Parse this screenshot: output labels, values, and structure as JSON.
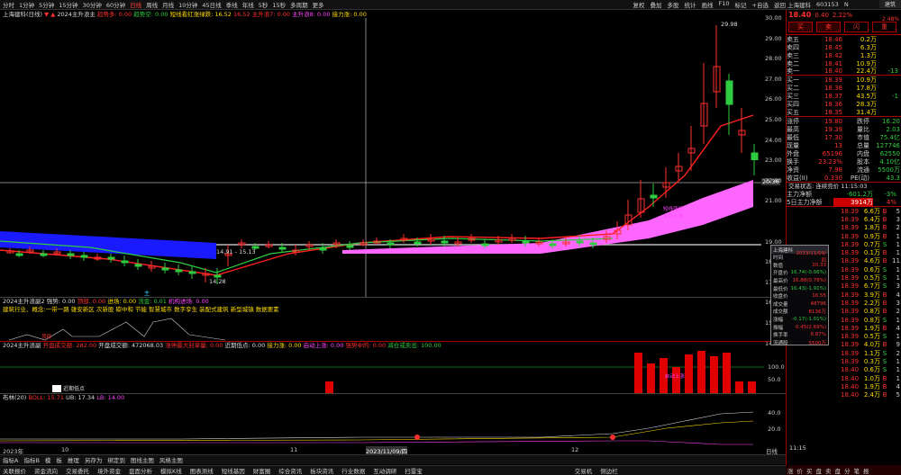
{
  "toolbar": {
    "items": [
      "分时",
      "1分钟",
      "5分钟",
      "15分钟",
      "30分钟",
      "60分钟",
      "日线",
      "周线",
      "月线",
      "10分钟",
      "45日线",
      "季线",
      "年线",
      "5秒",
      "15秒",
      "多周期",
      "更多"
    ],
    "right": [
      "复权",
      "叠加",
      "多股",
      "统计",
      "画线",
      "F10",
      "标记",
      "+自选",
      "返回"
    ]
  },
  "header": {
    "stock": "上海建科(日线)",
    "indicator": "2024主升浪主",
    "s1": "趋势多: 0.00",
    "s2": "趋势空: 0.00",
    "s3": "短线看红涨绿跌: 16.52",
    "s4": "16.52",
    "s5": "主升浪7: 0.00",
    "s6": "主升浪8: 0.00",
    "s7": "接力涨: 0.00"
  },
  "main": {
    "high_label": "29.98",
    "current": "20.36",
    "range": "14.91 - 15.13",
    "low": "14.28",
    "ann": "短线涨红",
    "ann2": "主力入场",
    "y_ticks": [
      "30.00",
      "29.00",
      "28.00",
      "27.00",
      "26.00",
      "25.00",
      "24.00",
      "23.00",
      "22.00",
      "21.00",
      "19.00",
      "18.00",
      "17.00",
      "16.00",
      "15.00",
      "14.00"
    ],
    "mark": "主"
  },
  "p2": {
    "title": "2024主升浪副2",
    "s": "强势: 0.00",
    "s2": "顶部: 0.00",
    "s3": "进场: 0.00",
    "s4": "流金: 0.01",
    "s5": "机构进场: 0.00",
    "text": "建筑行业、概念:一带一路 雄安新区 次新股 碳中和 节能 智慧城市 数字孪生 装配式建筑 新型城镇 数据要素",
    "label": "顶部"
  },
  "p3": {
    "title": "2024主升浪副",
    "s1": "开盘成交额: 282.00",
    "s2": "开盘成交额: 472068.03",
    "s3": "涨停最大封单量: 0.00",
    "s4": "近期低点: 0.00",
    "s5": "接力涨: 0.00",
    "s6": "启动上涨: 0.00",
    "s7": "强势中的: 0.00",
    "s8": "减仓或卖出: 100.00",
    "ticks": [
      "100.0",
      "50.0"
    ],
    "lab1": "近期低点",
    "lab2": "启动上涨"
  },
  "p4": {
    "title": "布林(20)",
    "boll": "BOLL: 15.71",
    "ub": "UB: 17.34",
    "lb": "LB: 14.00",
    "ticks": [
      "40.0",
      "20.0"
    ]
  },
  "xaxis": {
    "labels": [
      "2023年",
      "10",
      "11",
      "2023/11/09/四",
      "12"
    ],
    "unit": "日线"
  },
  "tabs": [
    "指标A",
    "指标B",
    "模",
    "板",
    "推理",
    "另存为",
    "绑定到",
    "图线主图",
    "风格主图"
  ],
  "bottom": [
    "关联报价",
    "资金流向",
    "交易委托",
    "境外资金",
    "盘面分析",
    "模拟K线",
    "图表测线",
    "短线基因",
    "财富圈",
    "综合资讯",
    "板块资讯",
    "行业数据",
    "互动调研",
    "扫雷宝",
    "交易机",
    "侧边栏"
  ],
  "quote": {
    "name": "上海建科",
    "code": "603153",
    "flag": "N",
    "price": "18.40",
    "change": "0.40",
    "pct": "2.22%",
    "tag1": "建筑",
    "tag2": "2.48%",
    "buy": "买",
    "sell": "卖",
    "b3": "闪",
    "b4": "重"
  },
  "book": [
    {
      "l": "卖五",
      "p": "18.46",
      "v": "0.2万",
      "d": ""
    },
    {
      "l": "卖四",
      "p": "18.45",
      "v": "6.3万",
      "d": ""
    },
    {
      "l": "卖三",
      "p": "18.42",
      "v": "1.3万",
      "d": ""
    },
    {
      "l": "卖二",
      "p": "18.41",
      "v": "10.9万",
      "d": ""
    },
    {
      "l": "卖一",
      "p": "18.40",
      "v": "22.4万",
      "d": "-13"
    },
    {
      "l": "买一",
      "p": "18.39",
      "v": "10.9万",
      "d": ""
    },
    {
      "l": "买二",
      "p": "18.38",
      "v": "17.8万",
      "d": ""
    },
    {
      "l": "买三",
      "p": "18.37",
      "v": "43.5万",
      "d": "-1"
    },
    {
      "l": "买四",
      "p": "18.36",
      "v": "28.3万",
      "d": ""
    },
    {
      "l": "买五",
      "p": "18.35",
      "v": "31.4万",
      "d": ""
    }
  ],
  "stats": [
    [
      "涨停",
      "19.80",
      "跌停",
      "16.20"
    ],
    [
      "最高",
      "19.39",
      "量比",
      "2.03"
    ],
    [
      "最低",
      "17.30",
      "市值",
      "75.4亿"
    ],
    [
      "现量",
      "13",
      "总量",
      "127746"
    ],
    [
      "外盘",
      "65196",
      "内盘",
      "62550"
    ],
    [
      "换手",
      "23.23%",
      "股本",
      "4.10亿"
    ],
    [
      "净资",
      "7.98",
      "流通",
      "5500万"
    ],
    [
      "收益(II)",
      "0.330",
      "PE(动)",
      "43.3"
    ]
  ],
  "trade_status": "交易状态: 连续竞价 11:15:03",
  "flow": [
    {
      "l": "主力净额",
      "v": "-601.2万",
      "p": "-3%"
    },
    {
      "l": "5日主力净额",
      "v": "3914万",
      "p": "4%"
    }
  ],
  "ticks": [
    [
      "6.6万",
      "B",
      "5"
    ],
    [
      "6.4万",
      "B",
      "3"
    ],
    [
      "1.8万",
      "B",
      "2"
    ],
    [
      "0.9万",
      "B",
      "1"
    ],
    [
      "0.7万",
      "S",
      "1"
    ],
    [
      "0.1万",
      "B",
      "1"
    ],
    [
      "4.6万",
      "B",
      "11"
    ],
    [
      "0.6万",
      "S",
      "1"
    ],
    [
      "0.5万",
      "S",
      "1"
    ],
    [
      "6.7万",
      "S",
      "3"
    ],
    [
      "3.9万",
      "B",
      "4"
    ],
    [
      "2.2万",
      "B",
      "3"
    ],
    [
      "0.8万",
      "B",
      "2"
    ],
    [
      "0.8万",
      "S",
      "1"
    ],
    [
      "1.9万",
      "B",
      "4"
    ],
    [
      "0.5万",
      "S",
      "1"
    ],
    [
      "4.0万",
      "B",
      "9"
    ],
    [
      "1.1万",
      "S",
      "2"
    ],
    [
      "0.3万",
      "S",
      "1"
    ],
    [
      "0.6万",
      "S",
      "1"
    ],
    [
      "1.0万",
      "B",
      "1"
    ],
    [
      "1.9万",
      "B",
      "4"
    ],
    [
      "2.4万",
      "B",
      "5"
    ]
  ],
  "tick_prices": [
    "18.39",
    "18.39",
    "18.39",
    "18.39",
    "18.39",
    "18.39",
    "18.39",
    "18.39",
    "18.39",
    "18.39",
    "18.39",
    "18.39",
    "18.39",
    "18.39",
    "18.39",
    "18.39",
    "18.39",
    "18.39",
    "18.39",
    "18.40",
    "18.40",
    "18.40",
    "18.40"
  ],
  "tick_time": "11:15",
  "popup": {
    "title": "上海建科",
    "rows": [
      [
        "时间",
        "2023/11/09/四"
      ],
      [
        "数值",
        "20.33"
      ],
      [
        "开盘价",
        "16.74(-0.06%)"
      ],
      [
        "最高价",
        "16.88(0.78%)"
      ],
      [
        "最低价",
        "16.43(-1.91%)"
      ],
      [
        "收盘价",
        "16.55"
      ],
      [
        "成交量",
        "48796"
      ],
      [
        "成交额",
        "8136万"
      ],
      [
        "涨幅",
        "-0.17(-1.01%)"
      ],
      [
        "振幅",
        "0.45(2.69%)"
      ],
      [
        "换手率",
        "8.87%"
      ],
      [
        "流通股",
        "5500万"
      ]
    ]
  },
  "bottom_right": [
    "涨",
    "价",
    "买",
    "盘",
    "卖",
    "盘",
    "分",
    "笔",
    "报"
  ]
}
